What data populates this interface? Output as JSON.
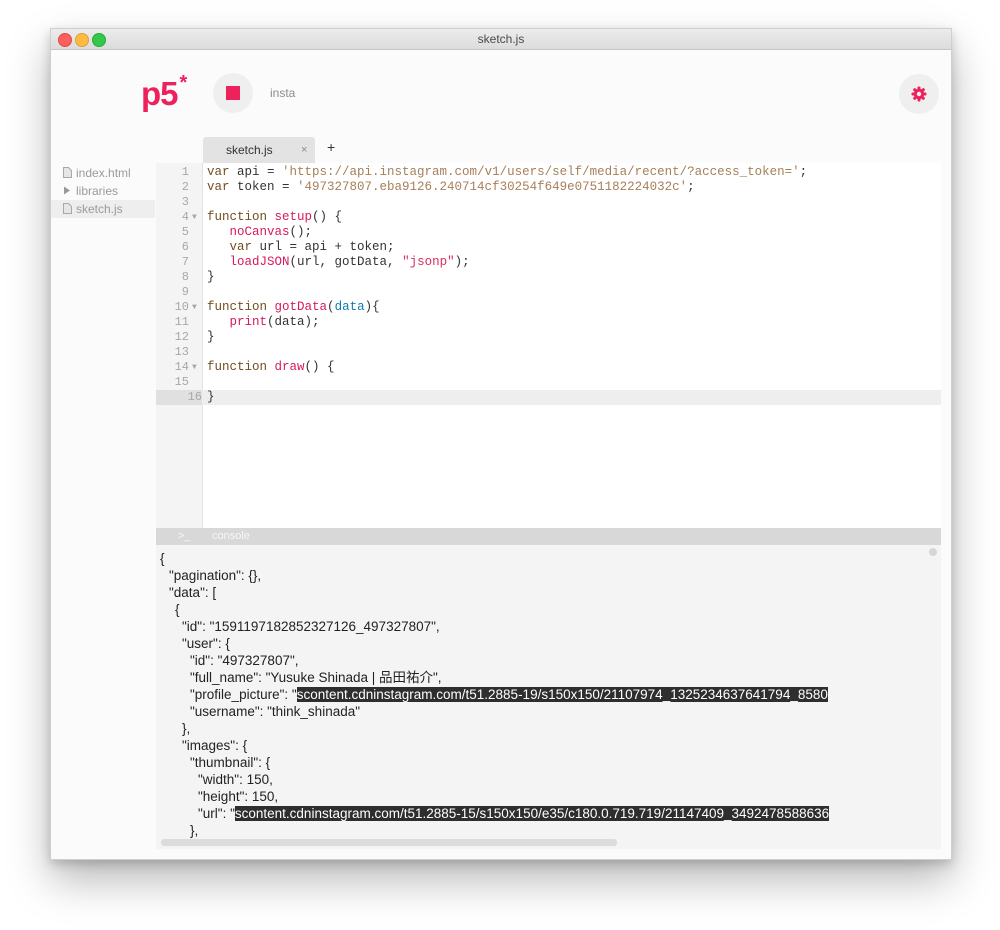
{
  "window": {
    "title": "sketch.js"
  },
  "header": {
    "logo": "p5",
    "logo_mark": "*",
    "sketch_name": "insta",
    "stop_icon": "stop-icon",
    "settings_icon": "gear-icon"
  },
  "tabs": {
    "active_label": "sketch.js",
    "close_label": "×",
    "new_label": "+"
  },
  "sidebar": {
    "items": [
      {
        "label": "index.html",
        "icon": "file-icon"
      },
      {
        "label": "libraries",
        "icon": "folder-triangle-icon"
      },
      {
        "label": "sketch.js",
        "icon": "file-icon"
      }
    ]
  },
  "editor": {
    "line_numbers": [
      "1",
      "2",
      "3",
      "4",
      "5",
      "6",
      "7",
      "8",
      "9",
      "10",
      "11",
      "12",
      "13",
      "14",
      "15",
      "16"
    ],
    "code": {
      "l1_kw": "var",
      "l1_var": " api = ",
      "l1_str": "'https://api.instagram.com/v1/users/self/media/recent/?access_token='",
      "l1_end": ";",
      "l2_kw": "var",
      "l2_var": " token = ",
      "l2_str": "'497327807.eba9126.240714cf30254f649e0751182224032c'",
      "l2_end": ";",
      "l4_kw": "function",
      "l4_fn": "setup",
      "l4_end": "() {",
      "l5_fn": "noCanvas",
      "l5_end": "();",
      "l6_kw": "var",
      "l6_rest": " url = api + token;",
      "l7_fn": "loadJSON",
      "l7_mid": "(url, gotData, ",
      "l7_str": "\"jsonp\"",
      "l7_end": ");",
      "l8": "}",
      "l10_kw": "function",
      "l10_fn": "gotData",
      "l10_open": "(",
      "l10_arg": "data",
      "l10_end": "){",
      "l11_fn": "print",
      "l11_end": "(data);",
      "l12": "}",
      "l14_kw": "function",
      "l14_fn": "draw",
      "l14_end": "() {",
      "l16": "}"
    }
  },
  "console": {
    "prompt": ">_",
    "label": "console",
    "lines": {
      "c1": "{",
      "c2": "\"pagination\": {},",
      "c3": "\"data\": [",
      "c4": "{",
      "c5": "\"id\": \"1591197182852327126_497327807\",",
      "c6": "\"user\": {",
      "c7": "\"id\": \"497327807\",",
      "c8": "\"full_name\": \"Yusuke Shinada | 品田祐介\",",
      "c9_key": "\"profile_picture\": \"",
      "c9_url": "scontent.cdninstagram.com/t51.2885-19/s150x150/21107974_1325234637641794_8580",
      "c10": "\"username\": \"think_shinada\"",
      "c11": "},",
      "c12": "\"images\": {",
      "c13": "\"thumbnail\": {",
      "c14": "\"width\": 150,",
      "c15": "\"height\": 150,",
      "c16_key": "\"url\": \"",
      "c16_url": "scontent.cdninstagram.com/t51.2885-15/s150x150/e35/c180.0.719.719/21147409_3492478588636",
      "c17": "},"
    }
  }
}
